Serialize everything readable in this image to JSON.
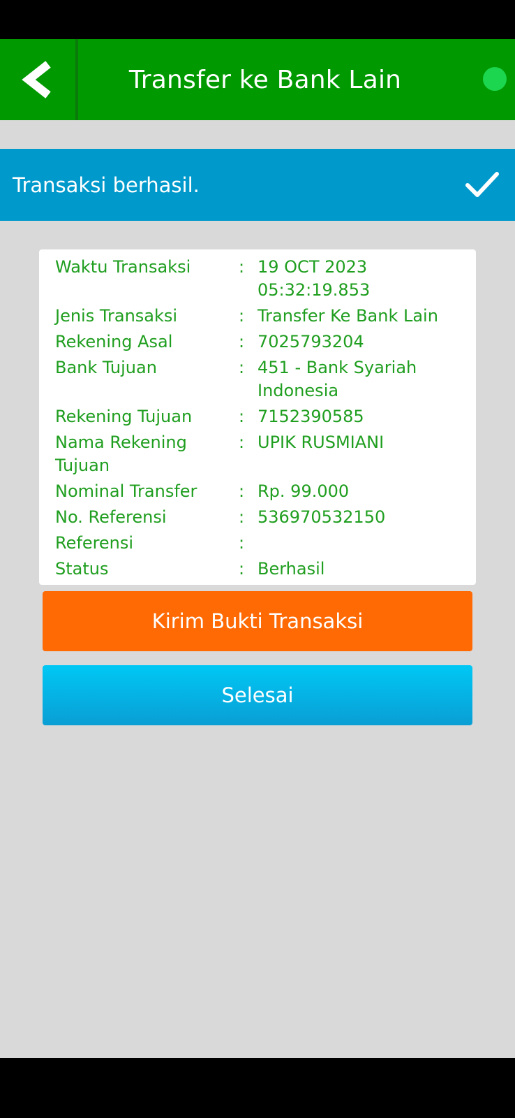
{
  "header": {
    "title": "Transfer ke Bank Lain"
  },
  "banner": {
    "message": "Transaksi berhasil."
  },
  "details": [
    {
      "label": "Waktu Transaksi",
      "colon": ":",
      "value": "19 OCT 2023\n05:32:19.853"
    },
    {
      "label": "Jenis Transaksi",
      "colon": ":",
      "value": "Transfer Ke Bank Lain"
    },
    {
      "label": "Rekening Asal",
      "colon": ":",
      "value": "7025793204"
    },
    {
      "label": "Bank Tujuan",
      "colon": ":",
      "value": "451 - Bank Syariah\nIndonesia"
    },
    {
      "label": "Rekening Tujuan",
      "colon": ":",
      "value": "7152390585"
    },
    {
      "label": "Nama Rekening\nTujuan",
      "colon": ":",
      "value": "UPIK RUSMIANI"
    },
    {
      "label": "Nominal Transfer",
      "colon": ":",
      "value": "Rp. 99.000"
    },
    {
      "label": "No. Referensi",
      "colon": ":",
      "value": "536970532150"
    },
    {
      "label": "Referensi",
      "colon": ":",
      "value": ""
    },
    {
      "label": "Status",
      "colon": ":",
      "value": "Berhasil"
    }
  ],
  "buttons": {
    "send_receipt": "Kirim Bukti Transaksi",
    "done": "Selesai"
  },
  "colors": {
    "app_bar": "#009900",
    "banner": "#0099cc",
    "detail_text": "#1f9e1f",
    "send_button": "#ff6a05",
    "done_button": "#00b4e6"
  },
  "icons": {
    "back": "chevron-left-icon",
    "success": "check-icon",
    "status": "status-dot-icon"
  }
}
